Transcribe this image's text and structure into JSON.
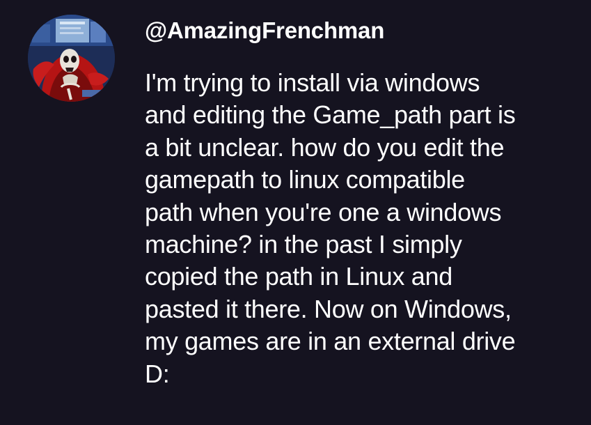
{
  "comment": {
    "avatar_icon": "user-avatar-skeleton-figure",
    "username": "@AmazingFrenchman",
    "lines": [
      "I'm trying to install via windows",
      "and editing the Game_path part is",
      "a bit unclear. how do you edit the",
      "gamepath to linux compatible",
      "path when you're one a windows",
      "machine? in the past I simply",
      "copied the path in Linux and",
      "pasted it there. Now on Windows,",
      "my games are in an external drive",
      "D:"
    ]
  },
  "colors": {
    "background": "#151320",
    "text": "#ffffff"
  }
}
